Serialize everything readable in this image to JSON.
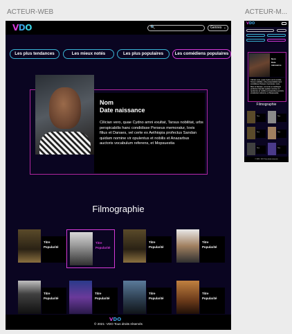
{
  "frames": {
    "web_label": "ACTEUR-WEB",
    "mobile_label": "ACTEUR-M..."
  },
  "header": {
    "logo": [
      "V",
      "D",
      "O"
    ],
    "search_placeholder": "",
    "genre_label": "Genres"
  },
  "tabs": [
    {
      "label": "Les plus tendances",
      "active": false
    },
    {
      "label": "Les mieux notés",
      "active": false
    },
    {
      "label": "Les plus populaires",
      "active": false
    },
    {
      "label": "Les comédiens populaires",
      "active": true
    }
  ],
  "actor": {
    "name": "Nom",
    "birth": "Date naissance",
    "bio": "Cilician vero, quae Cydno amni exultat, Tarsus nobilitat, urbs perspicabilis hanc condidisse Perseus memoratur, Iovis filius et Danaes, vel certe ex Aethiopia profectus Sandan quidam nomine vir opulentus et nobilis et Anazarbus auctoris vocabulum referens, et Mopsuestia"
  },
  "filmography": {
    "title": "Filmographie",
    "movies": [
      {
        "title": "Titre",
        "popularity": "Popularité",
        "poster": "poster-legend",
        "selected": false
      },
      {
        "title": "Titre",
        "popularity": "Popularité",
        "poster": "poster-hancock",
        "selected": true
      },
      {
        "title": "Titre",
        "popularity": "Popularité",
        "poster": "poster-legend",
        "selected": false
      },
      {
        "title": "Titre",
        "popularity": "Popularité",
        "poster": "poster-badboys",
        "selected": false
      },
      {
        "title": "Titre",
        "popularity": "Popularité",
        "poster": "poster-mib",
        "selected": false
      },
      {
        "title": "Titre",
        "popularity": "Popularité",
        "poster": "poster-aladdin",
        "selected": false
      },
      {
        "title": "Titre",
        "popularity": "Popularité",
        "poster": "poster-irobot",
        "selected": false
      },
      {
        "title": "Titre",
        "popularity": "Popularité",
        "poster": "poster-badboys2",
        "selected": false
      }
    ]
  },
  "footer": {
    "logo": "VDO",
    "text": "© 2021- VDO Tous droits réservés"
  },
  "mobile": {
    "name": "Nom",
    "birth": "Date naissance",
    "film_title": "Filmographie"
  },
  "colors": {
    "background": "#0a0521",
    "accent_pink": "#d63ad8",
    "accent_cyan": "#3ab6d6",
    "card_border": "#b1269f"
  }
}
